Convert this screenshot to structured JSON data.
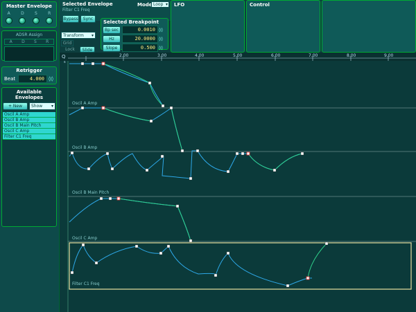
{
  "master_envelope": {
    "title": "Master Envelope",
    "knobs": [
      "A",
      "D",
      "S",
      "R"
    ]
  },
  "adsr": {
    "title": "ADSR Assign",
    "slots": [
      "A",
      "D",
      "S",
      "R"
    ]
  },
  "retrigger": {
    "title": "Retrigger",
    "label": "Beat",
    "value": "4.000"
  },
  "available": {
    "title": "Available Envelopes",
    "new_label": "+ New",
    "show_label": "Show",
    "items": [
      "Oscil A Amp",
      "Oscil B Amp",
      "Oscil B Main Pitch",
      "Oscil C Amp",
      "Filter C1 Freq"
    ]
  },
  "selected_envelope": {
    "title": "Selected Envelope",
    "name": "Filter C1 Freq",
    "mode_label": "Mode",
    "mode_value": "Loop",
    "bypass": "Bypass",
    "sync": "Sync"
  },
  "selected_breakpoint": {
    "title": "Selected Breakpoint",
    "rows": [
      {
        "label": "Bp sec",
        "value": "0.0010"
      },
      {
        "label": "Hz",
        "value": "20.0000"
      },
      {
        "label": "Slope",
        "value": "0.500"
      }
    ]
  },
  "transform": {
    "label": "Transform",
    "grid": "Grid",
    "lock": "Lock",
    "slide": "Slide"
  },
  "tabs": {
    "lfo": "LFO",
    "control": "Control"
  },
  "ruler": {
    "ticks": [
      "2.00",
      "3.00",
      "4.00",
      "5.00",
      "6.00",
      "7.00",
      "8.00",
      "9.00"
    ],
    "marks": [
      "Q",
      "s"
    ]
  },
  "lanes": [
    "Oscil A Amp",
    "Oscil B Amp",
    "Oscil B Main Pitch",
    "Oscil C Amp",
    "Filter C1 Freq"
  ],
  "colors": {
    "bg": "#0c3434",
    "curve_blue": "#2ea8e8",
    "curve_green": "#2fd08a",
    "selected_lane": "#e8e0a0"
  }
}
